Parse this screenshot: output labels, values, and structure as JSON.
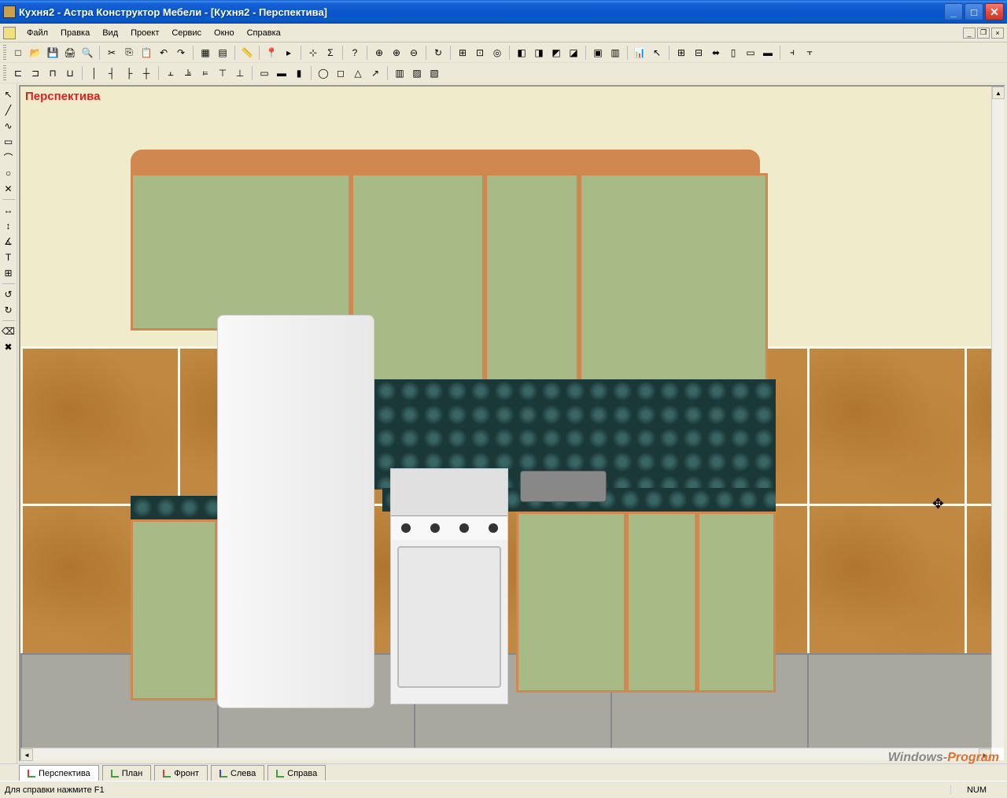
{
  "titlebar": {
    "title": "Кухня2 - Астра Конструктор Мебели - [Кухня2 - Перспектива]"
  },
  "menu": {
    "items": [
      "Файл",
      "Правка",
      "Вид",
      "Проект",
      "Сервис",
      "Окно",
      "Справка"
    ]
  },
  "viewport": {
    "label": "Перспектива"
  },
  "view_tabs": [
    {
      "label": "Перспектива",
      "active": true,
      "color": "#d04040"
    },
    {
      "label": "План",
      "active": false,
      "color": "#40a040"
    },
    {
      "label": "Фронт",
      "active": false,
      "color": "#d04040"
    },
    {
      "label": "Слева",
      "active": false,
      "color": "#4040d0"
    },
    {
      "label": "Справа",
      "active": false,
      "color": "#40a040"
    }
  ],
  "statusbar": {
    "help_text": "Для справки нажмите F1",
    "num_indicator": "NUM"
  },
  "watermark": {
    "part1": "Windows-",
    "part2": "Program"
  },
  "toolbar1_icons": [
    "new",
    "open",
    "save",
    "print",
    "preview",
    "",
    "cut",
    "copy",
    "paste",
    "undo",
    "redo",
    "",
    "layers",
    "grid",
    "",
    "ruler",
    "",
    "mark-red",
    "mark-gray",
    "",
    "axes",
    "sum",
    "",
    "help",
    "",
    "zoom-fit",
    "zoom-in",
    "zoom-out",
    "",
    "refresh",
    "",
    "snap",
    "target",
    "origin",
    "",
    "cube1",
    "cube2",
    "cube3",
    "cube4",
    "",
    "box1",
    "box2",
    "",
    "graph",
    "cursor",
    "",
    "grid1",
    "grid2",
    "grow",
    "panel1",
    "panel2",
    "panel3",
    "",
    "split1",
    "split2"
  ],
  "toolbar2_icons": [
    "shelf1",
    "shelf2",
    "shelf3",
    "shelf4",
    "",
    "div1",
    "div2",
    "div3",
    "div4",
    "",
    "align1",
    "align2",
    "align3",
    "align4",
    "align5",
    "",
    "panel-h1",
    "panel-h2",
    "panel-h3",
    "",
    "cyl",
    "cube",
    "cone",
    "arrow",
    "",
    "wall1",
    "wall2",
    "wall3"
  ],
  "left_tools": [
    "select",
    "line-a",
    "curve",
    "rect",
    "arc",
    "circle",
    "cross",
    "",
    "dim-h",
    "dim-v",
    "dim-a",
    "text",
    "table",
    "",
    "rot-l",
    "rot-r",
    "",
    "del1",
    "del2"
  ]
}
